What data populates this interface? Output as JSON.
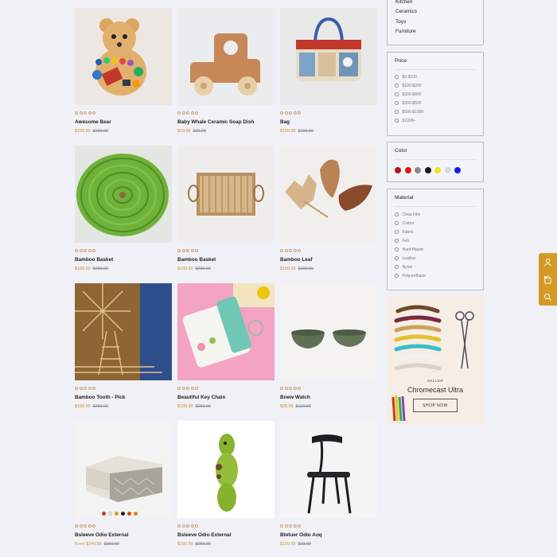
{
  "products": [
    {
      "name": "Awesome Bear",
      "price": "$199.99",
      "old_price": "$299.99"
    },
    {
      "name": "Baby Whale Ceramic Soap Dish",
      "price": "$19.99",
      "old_price": "$39.99"
    },
    {
      "name": "Bag",
      "price": "$199.99",
      "old_price": "$299.99"
    },
    {
      "name": "Bamboo Basket",
      "price": "$199.99",
      "old_price": "$299.99"
    },
    {
      "name": "Bamboo Basket",
      "price": "$199.99",
      "old_price": "$299.99"
    },
    {
      "name": "Bamboo Leaf",
      "price": "$199.99",
      "old_price": "$299.99"
    },
    {
      "name": "Bamboo Tooth - Pick",
      "price": "$199.99",
      "old_price": "$259.99"
    },
    {
      "name": "Beautiful Key Chain",
      "price": "$199.99",
      "old_price": "$259.99"
    },
    {
      "name": "Bnew Watch",
      "price": "$99.99",
      "old_price": "$119.99"
    },
    {
      "name": "Bsleeve Odio External",
      "price": "From $349.99",
      "old_price": "$339.99"
    },
    {
      "name": "Bsleeve Odio External",
      "price": "$199.99",
      "old_price": "$259.99"
    },
    {
      "name": "Btetuer Odio Aoq",
      "price": "$199.99",
      "old_price": "$29.99"
    }
  ],
  "product_swatches": [
    "#c0392b",
    "#eeeeee",
    "#d4a017",
    "#222222",
    "#d35400",
    "#e67e22"
  ],
  "sidebar": {
    "categories": [
      "Kitchen",
      "Ceramics",
      "Toys",
      "Furniture"
    ],
    "price": {
      "title": "Price",
      "options": [
        "$0-$100",
        "$100-$200",
        "$200-$400",
        "$300-$500",
        "$500-$1000",
        "$1000+"
      ]
    },
    "color": {
      "title": "Color",
      "swatches": [
        "#b0171f",
        "#e0141c",
        "#8a8a8a",
        "#1a1a1a",
        "#f5e11a",
        "#d6d6e6",
        "#1022e0"
      ]
    },
    "material": {
      "title": "Material",
      "options": [
        "Clear Film",
        "Cotton",
        "Fabric",
        "Felt",
        "Hard Plastic",
        "Leather",
        "Nylon",
        "Polyurethane"
      ]
    }
  },
  "ad": {
    "seller": "SELLER",
    "title": "Chromecast Ultra",
    "button": "SHOP NOW"
  },
  "colors": {
    "price": "#c8912e",
    "toolbar": "#d39b26"
  },
  "toolbar_icons": [
    "user-icon",
    "cart-icon",
    "search-icon"
  ]
}
